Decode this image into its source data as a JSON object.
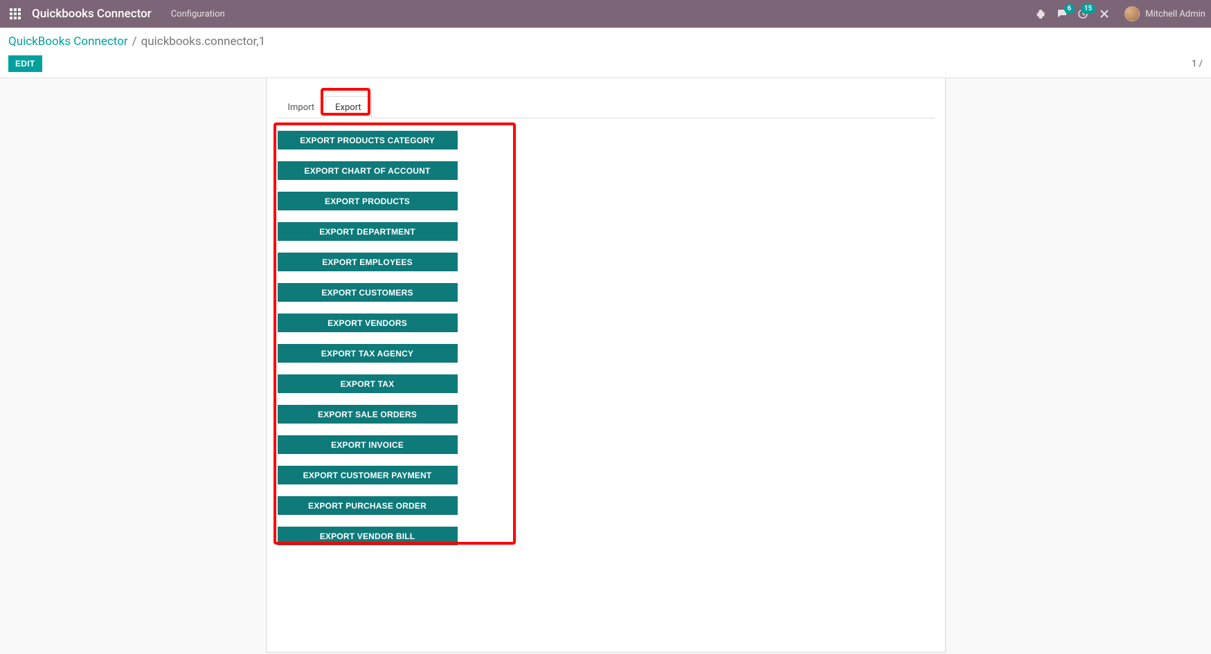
{
  "topbar": {
    "title": "Quickbooks Connector",
    "menu_config": "Configuration",
    "msg_badge": "6",
    "activity_badge": "15",
    "user_name": "Mitchell Admin"
  },
  "control": {
    "breadcrumb_root": "QuickBooks Connector",
    "breadcrumb_sep": "/",
    "breadcrumb_current": "quickbooks.connector,1",
    "edit_label": "EDIT",
    "pager": "1 /"
  },
  "tabs": {
    "import_label": "Import",
    "export_label": "Export"
  },
  "export_buttons": [
    "EXPORT PRODUCTS CATEGORY",
    "EXPORT CHART OF ACCOUNT",
    "EXPORT PRODUCTS",
    "EXPORT DEPARTMENT",
    "EXPORT EMPLOYEES",
    "EXPORT CUSTOMERS",
    "EXPORT VENDORS",
    "EXPORT TAX AGENCY",
    "EXPORT TAX",
    "EXPORT SALE ORDERS",
    "EXPORT INVOICE",
    "EXPORT CUSTOMER PAYMENT",
    "EXPORT PURCHASE ORDER",
    "EXPORT VENDOR BILL"
  ]
}
